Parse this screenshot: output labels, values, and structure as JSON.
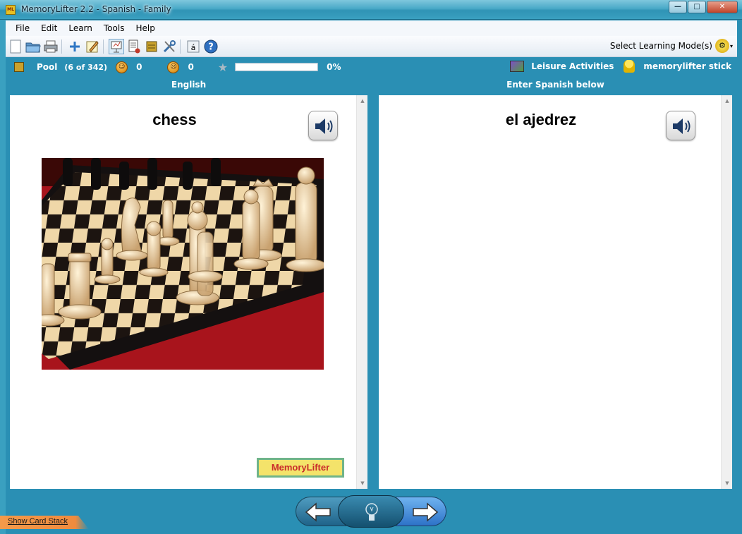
{
  "window": {
    "app_icon": "ML",
    "title": "MemoryLifter 2.2 - Spanish - Family",
    "buttons": {
      "minimize": "—",
      "maximize": "□",
      "close": "✕"
    }
  },
  "menu": {
    "items": [
      "File",
      "Edit",
      "Learn",
      "Tools",
      "Help"
    ]
  },
  "toolbar": {
    "buttons": [
      {
        "icon": "new-document-icon",
        "glyph": "🗋"
      },
      {
        "icon": "open-folder-icon",
        "glyph": "📂"
      },
      {
        "icon": "print-icon",
        "glyph": "🖨"
      },
      {
        "icon": "add-card-icon",
        "glyph": "+"
      },
      {
        "icon": "edit-card-icon",
        "glyph": "✎"
      },
      {
        "icon": "slideshow-icon",
        "glyph": "▤"
      },
      {
        "icon": "card-list-icon",
        "glyph": "▦"
      },
      {
        "icon": "box-icon",
        "glyph": "▣"
      },
      {
        "icon": "tools-icon",
        "glyph": "⚒"
      },
      {
        "icon": "special-character-icon",
        "glyph": "á"
      },
      {
        "icon": "help-icon",
        "glyph": "?"
      }
    ],
    "learning_mode_label": "Select Learning Mode(s)",
    "gear_glyph": "⚙"
  },
  "status": {
    "pool_label": "Pool",
    "pool_count": "(6 of 342)",
    "correct_count": "0",
    "wrong_count": "0",
    "progress_percent": "0%",
    "progress_value": 0,
    "category": "Leisure Activities",
    "user": "memorylifter stick",
    "happy_glyph": "☺",
    "sad_glyph": "☹",
    "star_glyph": "★"
  },
  "question": {
    "header": "English",
    "word": "chess"
  },
  "answer": {
    "header": "Enter Spanish below",
    "word": "el ajedrez"
  },
  "logo": {
    "text": "MemoryLifter"
  },
  "scroll": {
    "up": "▲",
    "down": "▼"
  },
  "navigation": {
    "prev_glyph": "⇦",
    "hint_glyph": "💡",
    "next_glyph": "⇨"
  },
  "footer": {
    "show_card_stack": "Show Card Stack"
  },
  "colors": {
    "window_blue": "#2a8fb4",
    "card_bg": "#ffffff",
    "logo_yellow": "#f4e36a",
    "logo_red": "#c92a2a"
  }
}
